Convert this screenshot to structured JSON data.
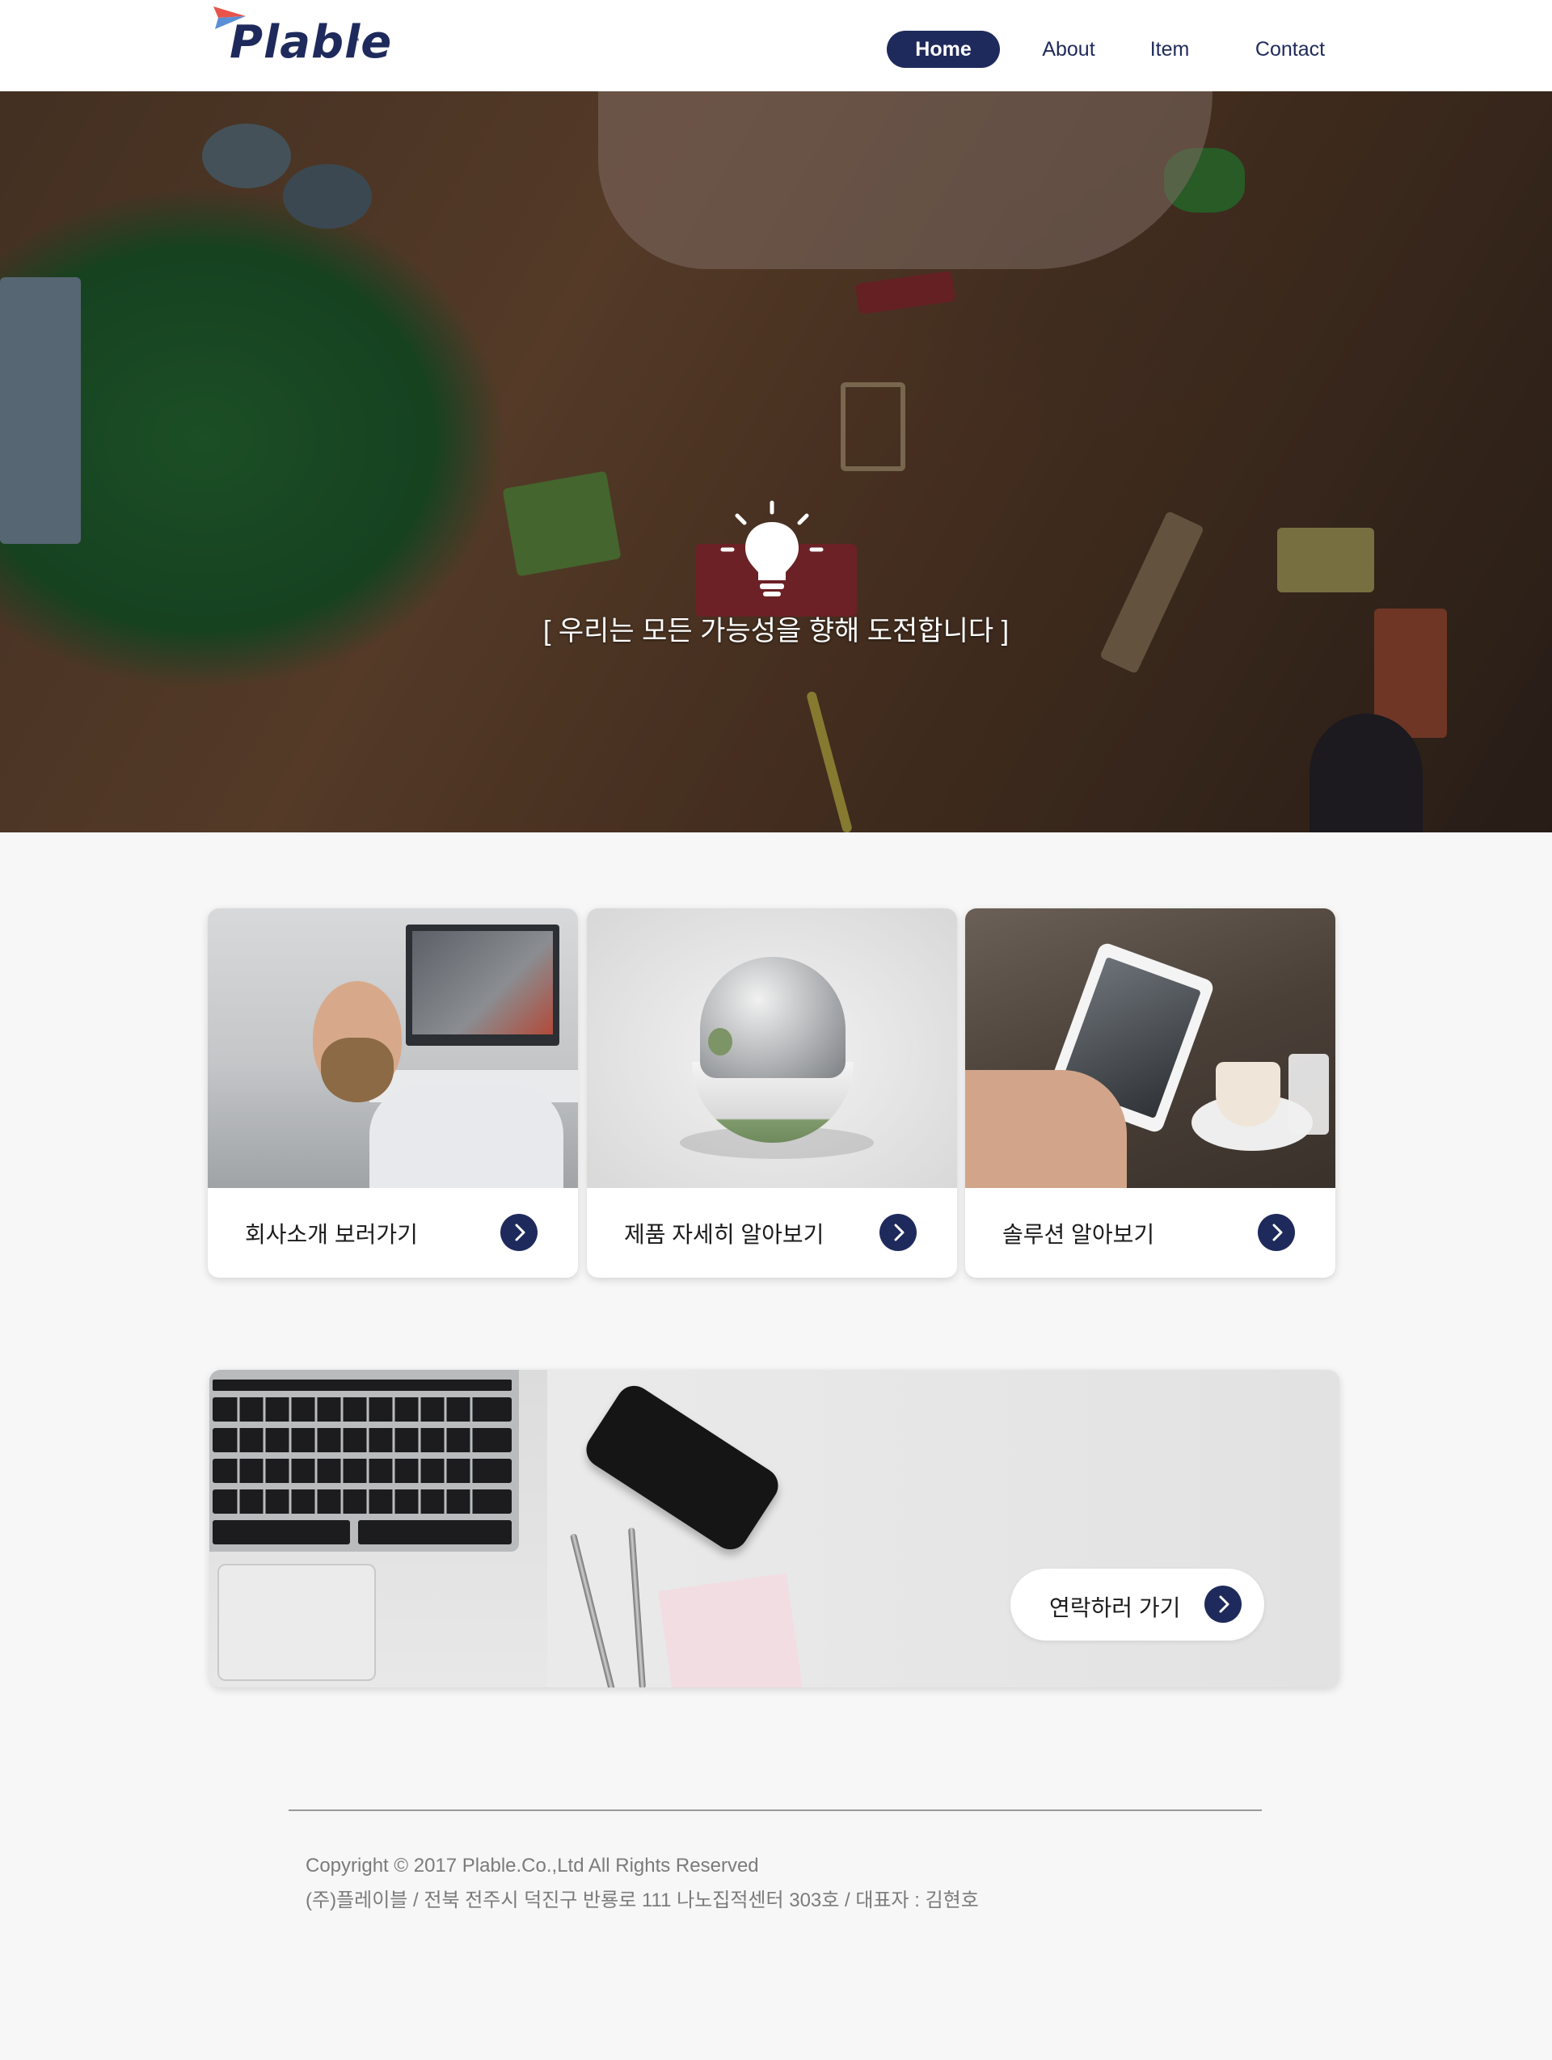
{
  "header": {
    "logo_text": "Plable",
    "logo_tm": "™",
    "nav": {
      "home": "Home",
      "about": "About",
      "item": "Item",
      "contact": "Contact"
    },
    "active_nav": "home"
  },
  "hero": {
    "icon": "lightbulb-icon",
    "tagline": "[ 우리는 모든 가능성을 향해 도전합니다 ]"
  },
  "cards": [
    {
      "label": "회사소개 보러가기",
      "image": "office-man-laughing",
      "icon": "chevron-right-icon"
    },
    {
      "label": "제품 자세히 알아보기",
      "image": "product-device-green-white",
      "icon": "chevron-right-icon"
    },
    {
      "label": "솔루션 알아보기",
      "image": "tablet-on-cafe-table",
      "icon": "chevron-right-icon"
    }
  ],
  "contact_banner": {
    "button_label": "연락하러 가기",
    "image": "laptop-phone-pens-desk",
    "icon": "chevron-right-icon"
  },
  "footer": {
    "copyright": "Copyright © 2017 Plable.Co.,Ltd All Rights Reserved",
    "company_info": "(주)플레이블 / 전북 전주시 덕진구 반룡로 111 나노집적센터 303호 / 대표자 : 김현호"
  },
  "colors": {
    "brand_navy": "#1f2a5c",
    "background": "#f7f7f7",
    "logo_accent_red": "#e8544b",
    "logo_accent_blue": "#5a8fd6"
  }
}
